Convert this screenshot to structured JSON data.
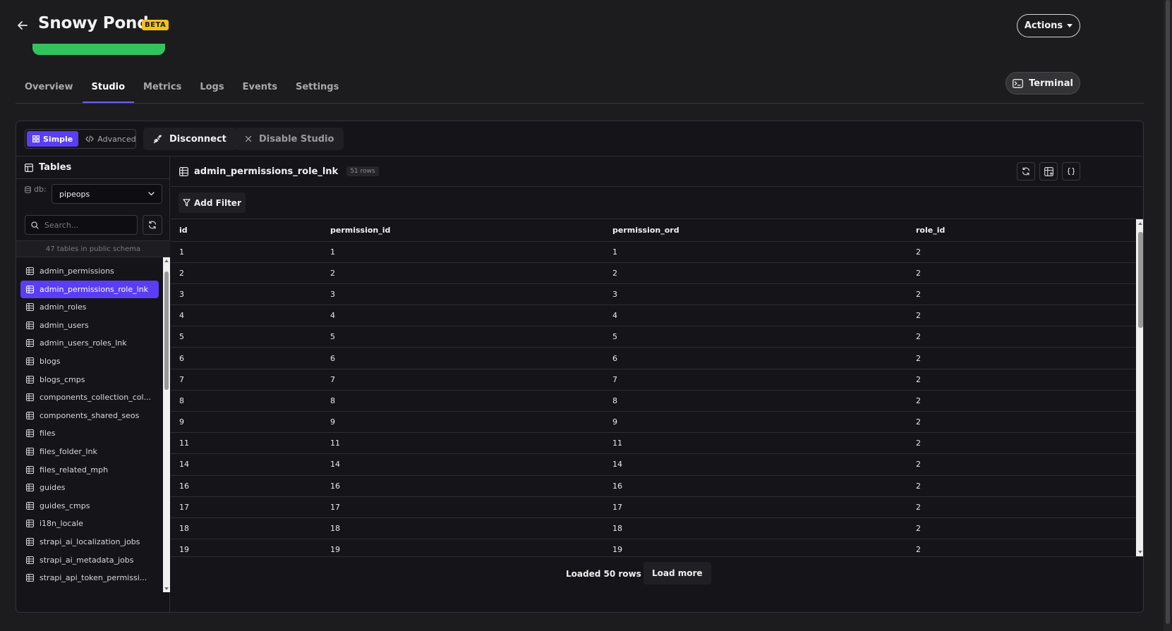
{
  "header": {
    "title": "Snowy Pond",
    "badge": "BETA",
    "actions_label": "Actions"
  },
  "tabs": [
    {
      "label": "Overview"
    },
    {
      "label": "Studio"
    },
    {
      "label": "Metrics"
    },
    {
      "label": "Logs"
    },
    {
      "label": "Events"
    },
    {
      "label": "Settings"
    }
  ],
  "active_tab": "Studio",
  "terminal_label": "Terminal",
  "toolbar": {
    "simple_label": "Simple",
    "advanced_label": "Advanced",
    "disconnect_label": "Disconnect",
    "disable_label": "Disable Studio"
  },
  "sidebar": {
    "heading": "Tables",
    "db_label": "db:",
    "db_value": "pipeops",
    "search_placeholder": "Search...",
    "tables_count": "47 tables in public schema",
    "tables": [
      "admin_permissions",
      "admin_permissions_role_lnk",
      "admin_roles",
      "admin_users",
      "admin_users_roles_lnk",
      "blogs",
      "blogs_cmps",
      "components_collection_col...",
      "components_shared_seos",
      "files",
      "files_folder_lnk",
      "files_related_mph",
      "guides",
      "guides_cmps",
      "i18n_locale",
      "strapi_ai_localization_jobs",
      "strapi_ai_metadata_jobs",
      "strapi_api_token_permissi..."
    ],
    "active_table": "admin_permissions_role_lnk"
  },
  "content": {
    "table_name": "admin_permissions_role_lnk",
    "row_badge": "51 rows",
    "add_filter_label": "Add Filter",
    "columns": [
      "id",
      "permission_id",
      "permission_ord",
      "role_id"
    ],
    "rows": [
      [
        "1",
        "1",
        "1",
        "2"
      ],
      [
        "2",
        "2",
        "2",
        "2"
      ],
      [
        "3",
        "3",
        "3",
        "2"
      ],
      [
        "4",
        "4",
        "4",
        "2"
      ],
      [
        "5",
        "5",
        "5",
        "2"
      ],
      [
        "6",
        "6",
        "6",
        "2"
      ],
      [
        "7",
        "7",
        "7",
        "2"
      ],
      [
        "8",
        "8",
        "8",
        "2"
      ],
      [
        "9",
        "9",
        "9",
        "2"
      ],
      [
        "11",
        "11",
        "11",
        "2"
      ],
      [
        "14",
        "14",
        "14",
        "2"
      ],
      [
        "16",
        "16",
        "16",
        "2"
      ],
      [
        "17",
        "17",
        "17",
        "2"
      ],
      [
        "18",
        "18",
        "18",
        "2"
      ],
      [
        "19",
        "19",
        "19",
        "2"
      ]
    ],
    "loaded_label": "Loaded 50 rows",
    "load_more_label": "Load more"
  },
  "icons": {
    "back": "arrow-left-icon",
    "terminal": "terminal-icon",
    "grid": "grid-icon",
    "code": "code-icon",
    "disconnect": "unplug-icon",
    "close": "close-icon",
    "table": "table-icon",
    "database": "database-icon",
    "search": "search-icon",
    "refresh": "refresh-icon",
    "filter": "filter-icon",
    "braces": "braces-icon"
  },
  "colors": {
    "accent": "#5b3df5",
    "beta": "#f2c21b",
    "status_green": "#33c35d",
    "background": "#1c1c1e"
  }
}
